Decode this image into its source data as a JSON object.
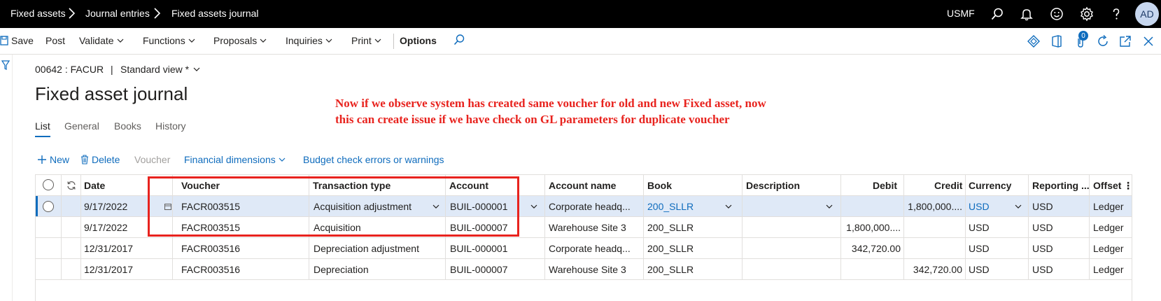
{
  "breadcrumb": [
    "Fixed assets",
    "Journal entries",
    "Fixed assets journal"
  ],
  "topbar": {
    "company": "USMF",
    "avatar": "AD"
  },
  "action_pane": {
    "items": [
      "Save",
      "Post",
      "Validate",
      "Functions",
      "Proposals",
      "Inquiries",
      "Print",
      "Options"
    ],
    "attachments_count": "0"
  },
  "header": {
    "journal": "00642 : FACUR",
    "separator": "|",
    "view": "Standard view *",
    "title": "Fixed asset journal"
  },
  "tabs": [
    "List",
    "General",
    "Books",
    "History"
  ],
  "note": "Now if we observe system has created same voucher for old and new Fixed asset, now this can create issue if we have check on GL parameters for duplicate voucher",
  "grid_toolbar": {
    "new": "New",
    "delete": "Delete",
    "voucher": "Voucher",
    "financial_dimensions": "Financial dimensions",
    "budget_check": "Budget check errors or warnings"
  },
  "grid": {
    "columns": [
      "Date",
      "Voucher",
      "Transaction type",
      "Account",
      "Account name",
      "Book",
      "Description",
      "Debit",
      "Credit",
      "Currency",
      "Reporting ...",
      "Offset"
    ],
    "rows": [
      {
        "date": "9/17/2022",
        "voucher": "FACR003515",
        "type": "Acquisition adjustment",
        "account": "BUIL-000001",
        "account_name": "Corporate headq...",
        "book": "200_SLLR",
        "description": "",
        "debit": "",
        "credit": "1,800,000....",
        "currency": "USD",
        "reporting": "USD",
        "offset": "Ledger"
      },
      {
        "date": "9/17/2022",
        "voucher": "FACR003515",
        "type": "Acquisition",
        "account": "BUIL-000007",
        "account_name": "Warehouse Site 3",
        "book": "200_SLLR",
        "description": "",
        "debit": "1,800,000....",
        "credit": "",
        "currency": "USD",
        "reporting": "USD",
        "offset": "Ledger"
      },
      {
        "date": "12/31/2017",
        "voucher": "FACR003516",
        "type": "Depreciation adjustment",
        "account": "BUIL-000001",
        "account_name": "Corporate headq...",
        "book": "200_SLLR",
        "description": "",
        "debit": "342,720.00",
        "credit": "",
        "currency": "USD",
        "reporting": "USD",
        "offset": "Ledger"
      },
      {
        "date": "12/31/2017",
        "voucher": "FACR003516",
        "type": "Depreciation",
        "account": "BUIL-000007",
        "account_name": "Warehouse Site 3",
        "book": "200_SLLR",
        "description": "",
        "debit": "",
        "credit": "342,720.00",
        "currency": "USD",
        "reporting": "USD",
        "offset": "Ledger"
      }
    ]
  },
  "colors": {
    "accent": "#0f6cbd",
    "annotation": "#e8231e",
    "selected_row": "#dfe9f7"
  }
}
